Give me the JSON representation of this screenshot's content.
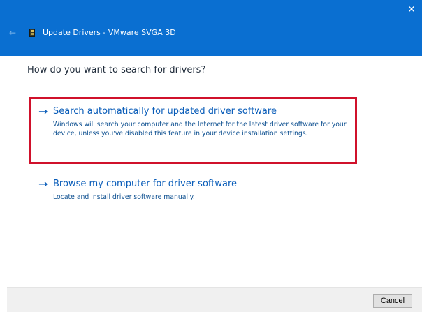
{
  "window": {
    "title": "Update Drivers - VMware SVGA 3D",
    "close_glyph": "✕",
    "back_glyph": "←",
    "accent_color": "#0a6fd1"
  },
  "main": {
    "heading": "How do you want to search for drivers?",
    "options": [
      {
        "title": "Search automatically for updated driver software",
        "description": "Windows will search your computer and the Internet for the latest driver software for your device, unless you've disabled this feature in your device installation settings.",
        "highlighted": true,
        "highlight_color": "#d0112b"
      },
      {
        "title": "Browse my computer for driver software",
        "description": "Locate and install driver software manually.",
        "highlighted": false
      }
    ]
  },
  "footer": {
    "cancel_label": "Cancel"
  },
  "icons": {
    "arrow": "→"
  }
}
